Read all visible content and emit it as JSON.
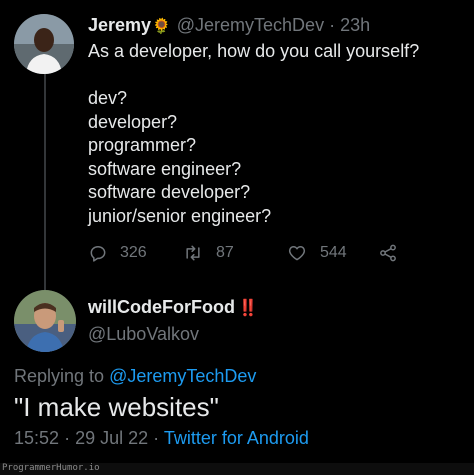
{
  "tweet1": {
    "display_name": "Jeremy",
    "emoji": "🌻",
    "handle": "@JeremyTechDev",
    "separator": "·",
    "time": "23h",
    "text": "As a developer, how do you call yourself?\n\ndev?\ndeveloper?\nprogrammer?\nsoftware engineer?\nsoftware developer?\njunior/senior engineer?",
    "replies": "326",
    "retweets": "87",
    "likes": "544"
  },
  "tweet2": {
    "display_name": "willCodeForFood",
    "badge": "‼️",
    "handle": "@LuboValkov",
    "replying_prefix": "Replying to ",
    "replying_to": "@JeremyTechDev",
    "text": "\"I make websites\"",
    "time": "15:52",
    "date": "29 Jul 22",
    "source": "Twitter for Android",
    "dot": "·"
  },
  "watermark": "ProgrammerHumor.io",
  "colors": {
    "background": "#000000",
    "text": "#e7e9ea",
    "muted": "#71767b",
    "link": "#1d9bf0"
  }
}
